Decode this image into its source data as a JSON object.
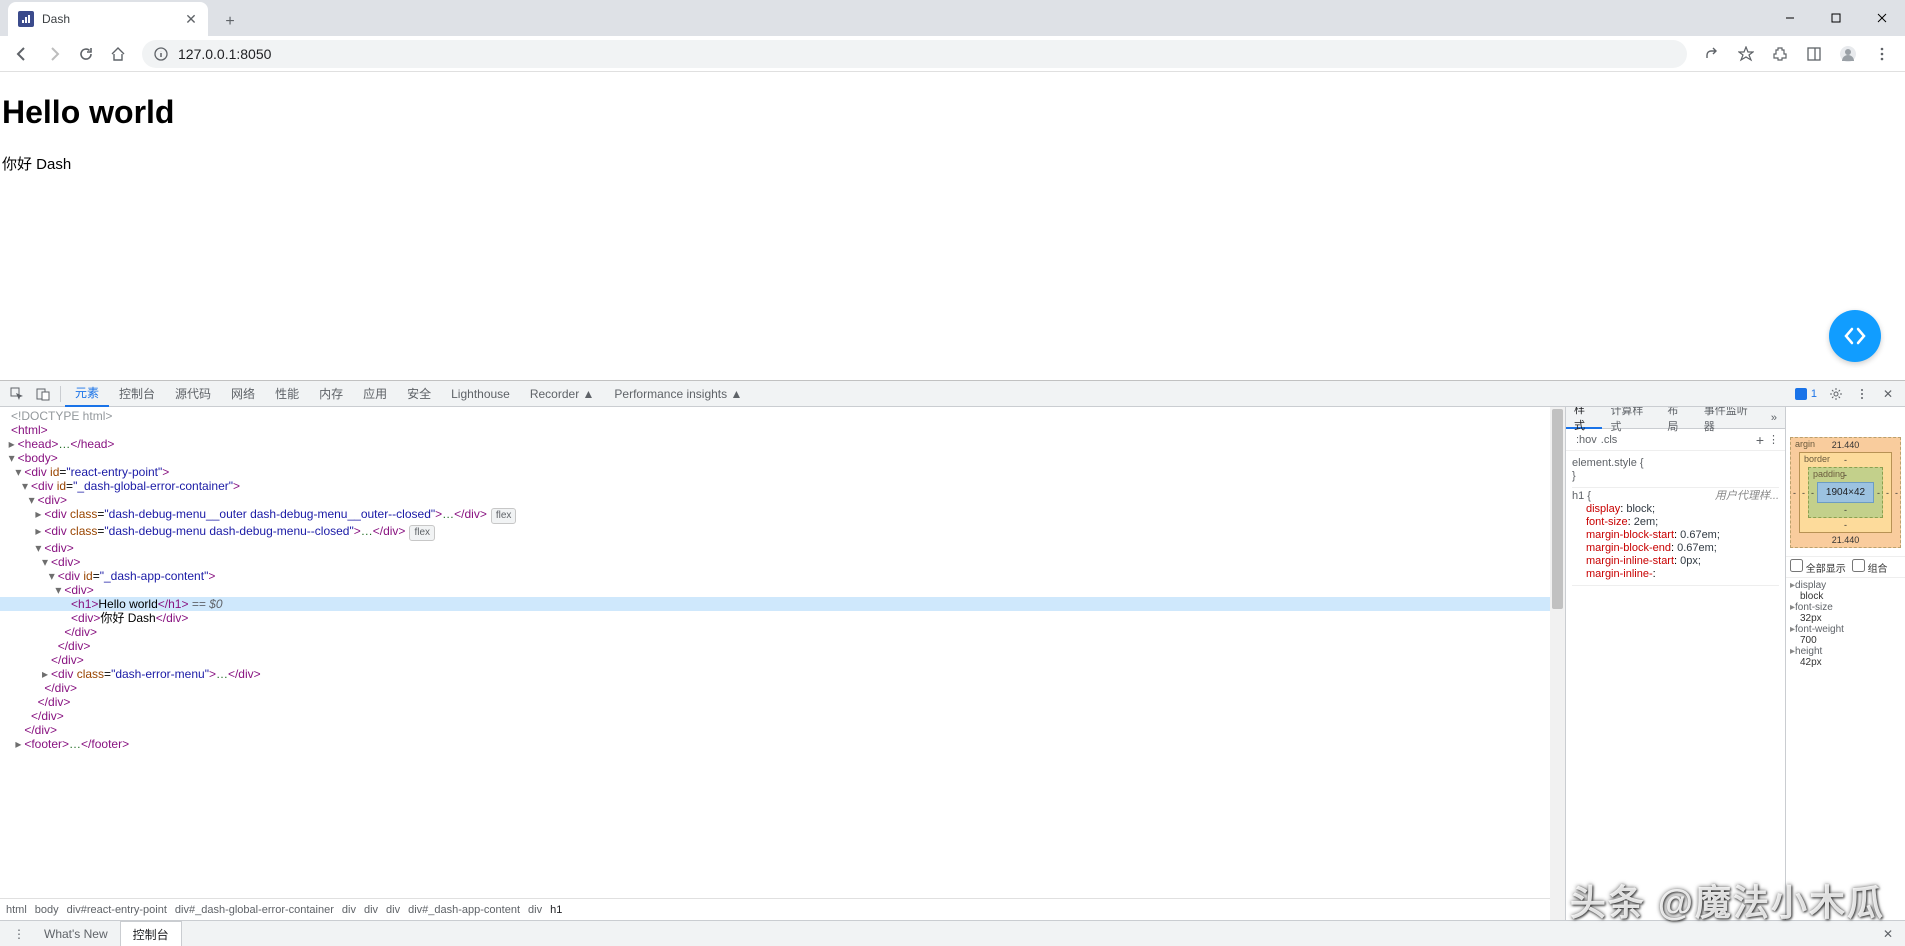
{
  "browser": {
    "tab_title": "Dash",
    "url": "127.0.0.1:8050"
  },
  "window_controls": {
    "minimize": "—",
    "maximize": "▢",
    "close": "✕"
  },
  "page": {
    "heading": "Hello world",
    "subtext": "你好 Dash"
  },
  "devtools": {
    "tabs": [
      "元素",
      "控制台",
      "源代码",
      "网络",
      "性能",
      "内存",
      "应用",
      "安全",
      "Lighthouse",
      "Recorder ▲",
      "Performance insights ▲"
    ],
    "active_tab": "元素",
    "issues_count": "1",
    "dom_lines": [
      {
        "depth": 0,
        "tri": "",
        "html": "<span class='c'>&lt;!DOCTYPE html&gt;</span>"
      },
      {
        "depth": 0,
        "tri": "",
        "html": "<span class='t'>&lt;html&gt;</span>"
      },
      {
        "depth": 1,
        "tri": "▸",
        "html": "<span class='t'>&lt;head&gt;</span><span class='x'>…</span><span class='t'>&lt;/head&gt;</span>"
      },
      {
        "depth": 1,
        "tri": "▾",
        "html": "<span class='t'>&lt;body&gt;</span>"
      },
      {
        "depth": 2,
        "tri": "▾",
        "html": "<span class='t'>&lt;div </span><span class='a'>id</span>=<span class='v'>\"react-entry-point\"</span><span class='t'>&gt;</span>"
      },
      {
        "depth": 3,
        "tri": "▾",
        "html": "<span class='t'>&lt;div </span><span class='a'>id</span>=<span class='v'>\"_dash-global-error-container\"</span><span class='t'>&gt;</span>"
      },
      {
        "depth": 4,
        "tri": "▾",
        "html": "<span class='t'>&lt;div&gt;</span>"
      },
      {
        "depth": 5,
        "tri": "▸",
        "html": "<span class='t'>&lt;div </span><span class='a'>class</span>=<span class='v'>\"dash-debug-menu__outer dash-debug-menu__outer--closed\"</span><span class='t'>&gt;</span><span class='x'>…</span><span class='t'>&lt;/div&gt;</span><span class='flex-badge'>flex</span>"
      },
      {
        "depth": 5,
        "tri": "▸",
        "html": "<span class='t'>&lt;div </span><span class='a'>class</span>=<span class='v'>\"dash-debug-menu dash-debug-menu--closed\"</span><span class='t'>&gt;</span><span class='x'>…</span><span class='t'>&lt;/div&gt;</span><span class='flex-badge'>flex</span>"
      },
      {
        "depth": 5,
        "tri": "▾",
        "html": "<span class='t'>&lt;div&gt;</span>"
      },
      {
        "depth": 6,
        "tri": "▾",
        "html": "<span class='t'>&lt;div&gt;</span>"
      },
      {
        "depth": 7,
        "tri": "▾",
        "html": "<span class='t'>&lt;div </span><span class='a'>id</span>=<span class='v'>\"_dash-app-content\"</span><span class='t'>&gt;</span>"
      },
      {
        "depth": 8,
        "tri": "▾",
        "html": "<span class='t'>&lt;div&gt;</span>"
      },
      {
        "depth": 9,
        "tri": "",
        "sel": true,
        "html": "<span class='t'>&lt;h1&gt;</span>Hello world<span class='t'>&lt;/h1&gt;</span> <span class='eq'>== $0</span>"
      },
      {
        "depth": 9,
        "tri": "",
        "html": "<span class='t'>&lt;div&gt;</span>你好 Dash<span class='t'>&lt;/div&gt;</span>"
      },
      {
        "depth": 8,
        "tri": "",
        "html": "<span class='t'>&lt;/div&gt;</span>"
      },
      {
        "depth": 7,
        "tri": "",
        "html": "<span class='t'>&lt;/div&gt;</span>"
      },
      {
        "depth": 6,
        "tri": "",
        "html": "<span class='t'>&lt;/div&gt;</span>"
      },
      {
        "depth": 6,
        "tri": "▸",
        "html": "<span class='t'>&lt;div </span><span class='a'>class</span>=<span class='v'>\"dash-error-menu\"</span><span class='t'>&gt;</span><span class='x'>…</span><span class='t'>&lt;/div&gt;</span>"
      },
      {
        "depth": 5,
        "tri": "",
        "html": "<span class='t'>&lt;/div&gt;</span>"
      },
      {
        "depth": 4,
        "tri": "",
        "html": "<span class='t'>&lt;/div&gt;</span>"
      },
      {
        "depth": 3,
        "tri": "",
        "html": "<span class='t'>&lt;/div&gt;</span>"
      },
      {
        "depth": 2,
        "tri": "",
        "html": "<span class='t'>&lt;/div&gt;</span>"
      },
      {
        "depth": 2,
        "tri": "▸",
        "html": "<span class='t'>&lt;footer&gt;</span><span class='x'>…</span><span class='t'>&lt;/footer&gt;</span>"
      }
    ],
    "breadcrumbs": [
      "html",
      "body",
      "div#react-entry-point",
      "div#_dash-global-error-container",
      "div",
      "div",
      "div",
      "div#_dash-app-content",
      "div",
      "h1"
    ],
    "styles_tabs": [
      "样式",
      "计算样式",
      "布局",
      "事件监听器"
    ],
    "filter_pills": [
      ":hov",
      ".cls",
      "+"
    ],
    "rules": {
      "element_style": "element.style {",
      "element_style_close": "}",
      "ua_source": "用户代理样...",
      "h1_selector": "h1 {",
      "props": [
        {
          "k": "display",
          "v": "block;"
        },
        {
          "k": "font-size",
          "v": "2em;"
        },
        {
          "k": "margin-block-start",
          "v": "0.67em;"
        },
        {
          "k": "margin-block-end",
          "v": "0.67em;"
        },
        {
          "k": "margin-inline-start",
          "v": "0px;"
        },
        {
          "k": "margin-inline-",
          "v": ""
        }
      ]
    },
    "boxmodel": {
      "margin_label": "argin",
      "border_label": "border",
      "padding_label": "padding",
      "margin_top": "21.440",
      "margin_bottom": "21.440",
      "border_val": "-",
      "padding_val": "-",
      "content": "1904×42",
      "side_dash": "-",
      "check_all": "全部显示",
      "check_group": "组合",
      "computed": [
        {
          "k": "display",
          "v": "block"
        },
        {
          "k": "font-size",
          "v": "32px"
        },
        {
          "k": "font-weight",
          "v": "700"
        },
        {
          "k": "height",
          "v": "42px"
        }
      ]
    },
    "drawer_tabs": [
      "What's New",
      "控制台"
    ]
  },
  "watermark": "头条 @魔法小木瓜"
}
